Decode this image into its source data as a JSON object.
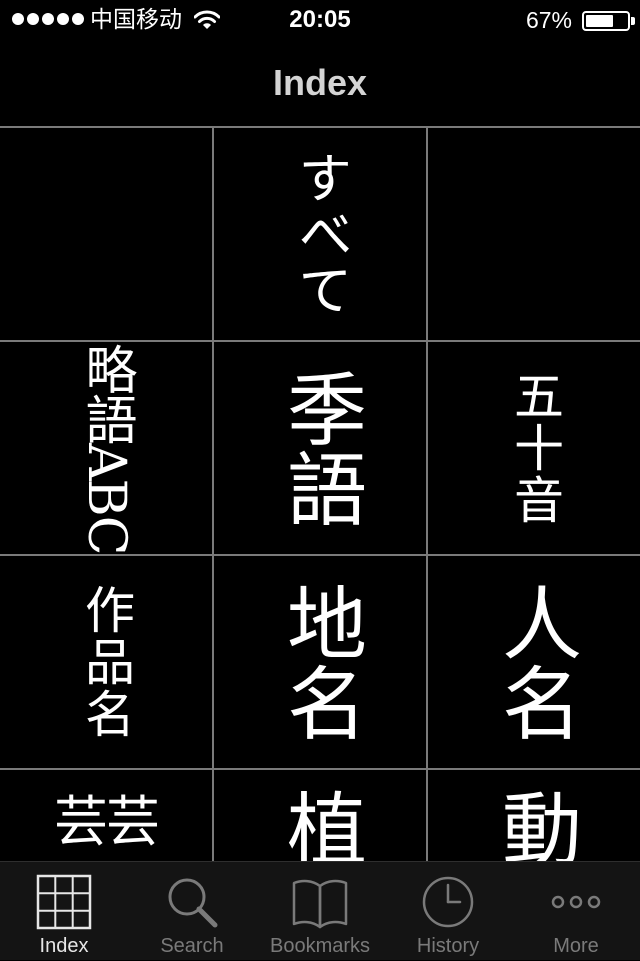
{
  "status_bar": {
    "carrier": "中国移动",
    "time": "20:05",
    "battery_percent_text": "67%",
    "battery_level": 0.67,
    "signal_bars": 5
  },
  "nav": {
    "title": "Index"
  },
  "grid": {
    "cells": [
      {
        "id": "empty-1",
        "text": ""
      },
      {
        "id": "all",
        "text": "すべて"
      },
      {
        "id": "empty-2",
        "text": ""
      },
      {
        "id": "abbreviation-abc",
        "text": "略語ABC"
      },
      {
        "id": "season-word",
        "text": "季語"
      },
      {
        "id": "gojuon",
        "text": "五十音"
      },
      {
        "id": "work-title",
        "text": "作品名"
      },
      {
        "id": "place-name",
        "text": "地名"
      },
      {
        "id": "person-name",
        "text": "人名"
      },
      {
        "id": "art-name",
        "text": "芸芸"
      },
      {
        "id": "plant",
        "text": "植"
      },
      {
        "id": "animal",
        "text": "動"
      }
    ]
  },
  "tabs": [
    {
      "id": "index",
      "label": "Index",
      "icon": "grid-icon",
      "active": true
    },
    {
      "id": "search",
      "label": "Search",
      "icon": "magnifier-icon",
      "active": false
    },
    {
      "id": "bookmarks",
      "label": "Bookmarks",
      "icon": "open-book-icon",
      "active": false
    },
    {
      "id": "history",
      "label": "History",
      "icon": "clock-icon",
      "active": false
    },
    {
      "id": "more",
      "label": "More",
      "icon": "more-dots-icon",
      "active": false
    }
  ],
  "colors": {
    "background": "#000000",
    "grid_line": "#7a7a7a",
    "tab_bar": "#141414",
    "tab_active": "#e6e6e6",
    "tab_inactive": "#7a7a7a",
    "nav_title": "#d4d4d4"
  }
}
